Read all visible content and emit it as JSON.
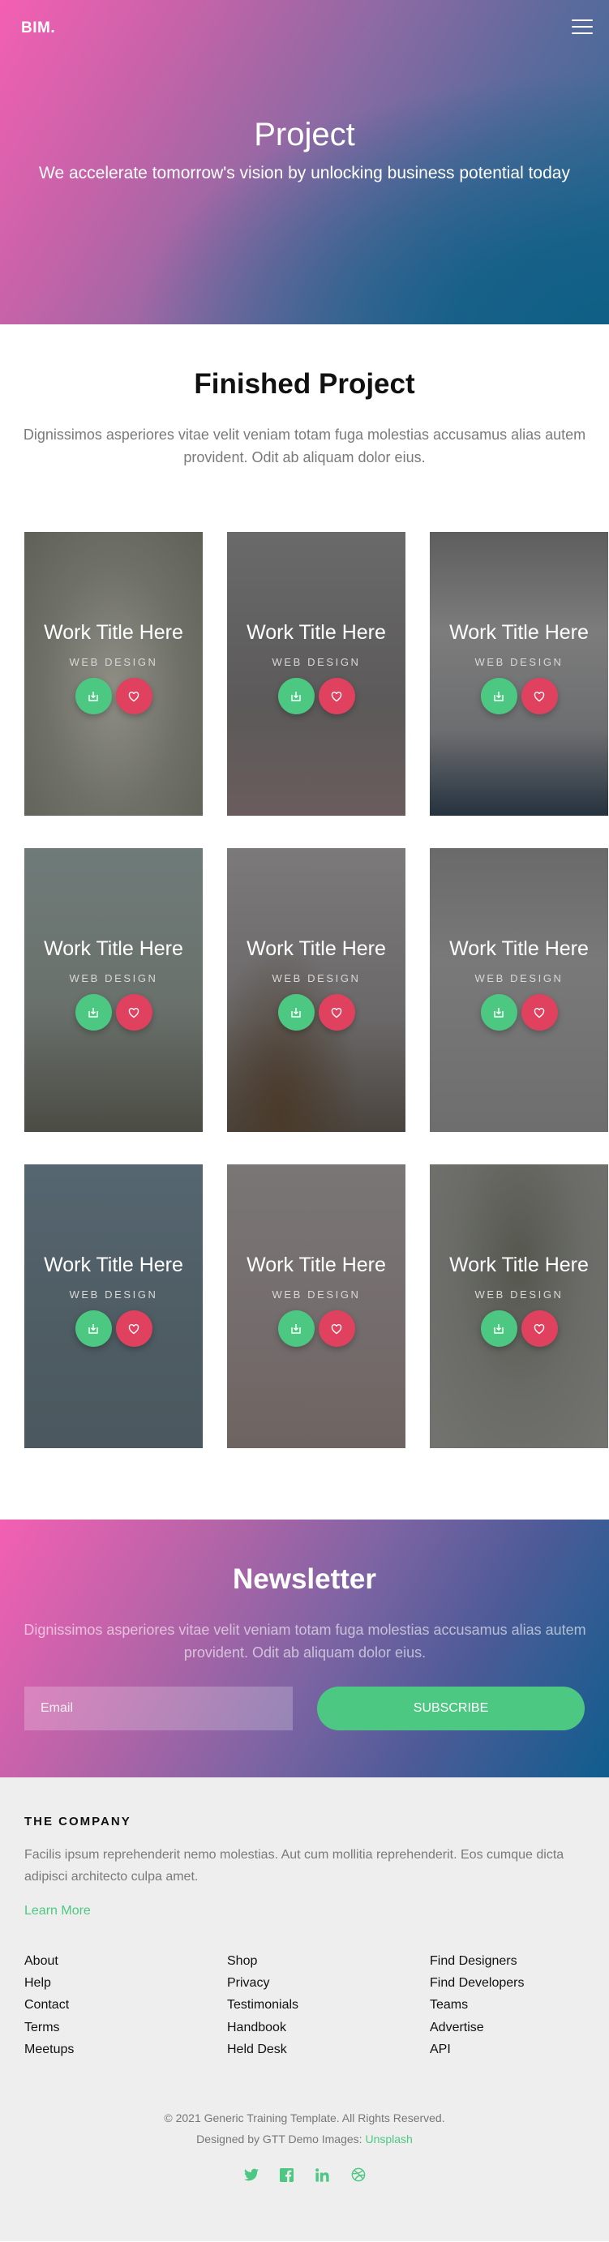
{
  "header": {
    "logo": "BIM.",
    "title": "Project",
    "subtitle": "We accelerate tomorrow's vision by unlocking business potential today"
  },
  "finished": {
    "title": "Finished Project",
    "description": "Dignissimos asperiores vitae velit veniam totam fuga molestias accusamus alias autem provident. Odit ab aliquam dolor eius."
  },
  "works": [
    {
      "title": "Work Title Here",
      "category": "WEB DESIGN"
    },
    {
      "title": "Work Title Here",
      "category": "WEB DESIGN"
    },
    {
      "title": "Work Title Here",
      "category": "WEB DESIGN"
    },
    {
      "title": "Work Title Here",
      "category": "WEB DESIGN"
    },
    {
      "title": "Work Title Here",
      "category": "WEB DESIGN"
    },
    {
      "title": "Work Title Here",
      "category": "WEB DESIGN"
    },
    {
      "title": "Work Title Here",
      "category": "WEB DESIGN"
    },
    {
      "title": "Work Title Here",
      "category": "WEB DESIGN"
    },
    {
      "title": "Work Title Here",
      "category": "WEB DESIGN"
    }
  ],
  "newsletter": {
    "title": "Newsletter",
    "description": "Dignissimos asperiores vitae velit veniam totam fuga molestias accusamus alias autem provident. Odit ab aliquam dolor eius.",
    "email_placeholder": "Email",
    "subscribe_label": "SUBSCRIBE"
  },
  "footer": {
    "company_heading": "THE COMPANY",
    "about": "Facilis ipsum reprehenderit nemo molestias. Aut cum mollitia reprehenderit. Eos cumque dicta adipisci architecto culpa amet.",
    "learn_more": "Learn More",
    "links": [
      [
        "About",
        "Help",
        "Contact",
        "Terms",
        "Meetups"
      ],
      [
        "Shop",
        "Privacy",
        "Testimonials",
        "Handbook",
        "Held Desk"
      ],
      [
        "Find Designers",
        "Find Developers",
        "Teams",
        "Advertise",
        "API"
      ]
    ],
    "copyright": "© 2021 Generic Training Template. All Rights Reserved.",
    "designed_by": "Designed by GTT Demo Images:",
    "images_link": "Unsplash",
    "social": [
      "twitter-icon",
      "facebook-icon",
      "linkedin-icon",
      "dribbble-icon"
    ]
  },
  "colors": {
    "accent_green": "#4dc882",
    "accent_red": "#e0415f",
    "gradient_pink": "#f45fb3",
    "gradient_blue": "#0f5d8d",
    "footer_bg": "#eeeeee"
  }
}
